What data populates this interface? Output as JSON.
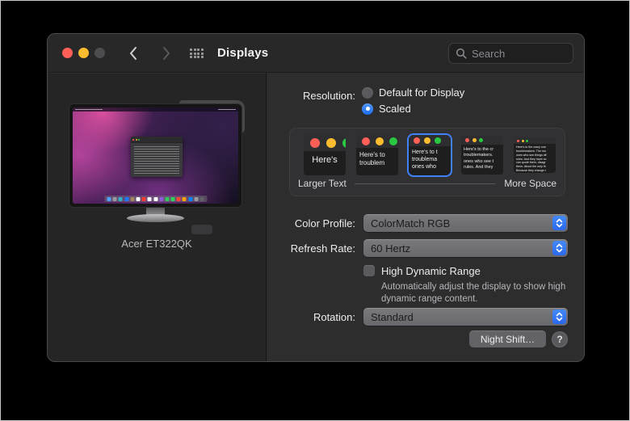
{
  "window": {
    "title": "Displays"
  },
  "titlebar": {
    "search_placeholder": "Search"
  },
  "resolution": {
    "label": "Resolution:",
    "options": [
      {
        "label": "Default for Display",
        "selected": false
      },
      {
        "label": "Scaled",
        "selected": true
      }
    ]
  },
  "scale_picker": {
    "larger_text_label": "Larger Text",
    "more_space_label": "More Space",
    "selected_index": 2,
    "thumbnails": [
      {
        "text": "Here's"
      },
      {
        "text": "Here's to\ntroublem"
      },
      {
        "text": "Here's to t\ntroublema\nones who"
      },
      {
        "text": "Here's to the cr\ntroublemakers.\nones who see t\nrules. And they"
      },
      {
        "text": "Here's to the crazy one\ntroublemakers. The rou\nones who see things dif\nrules. And they have no\ncan quote them, disagr\nthem. About the only th\nBecause they change t"
      }
    ]
  },
  "color_profile": {
    "label": "Color Profile:",
    "value": "ColorMatch RGB"
  },
  "refresh_rate": {
    "label": "Refresh Rate:",
    "value": "60 Hertz"
  },
  "hdr": {
    "label": "High Dynamic Range",
    "checked": false,
    "description": "Automatically adjust the display to show high dynamic range content."
  },
  "rotation": {
    "label": "Rotation:",
    "value": "Standard"
  },
  "footer": {
    "night_shift_label": "Night Shift…",
    "help_label": "?"
  },
  "preview": {
    "display_name": "Acer ET322QK",
    "dock_colors": [
      "#4da3ff",
      "#98989d",
      "#30b0c7",
      "#1c77ff",
      "#a2845e",
      "#ffffff",
      "#ff3b30",
      "#f5f5f7",
      "#ffffff",
      "#8e5cd9",
      "#34c759",
      "#30d158",
      "#ff453a",
      "#ff9f0a",
      "#0a84ff",
      "#98989d",
      "#636366"
    ]
  },
  "colors": {
    "accent_blue": "#2e7df6",
    "traffic_red": "#ff5f57",
    "traffic_yellow": "#febc2e",
    "traffic_disabled": "#4d4d4f",
    "thumb_dot_green": "#28c840"
  }
}
